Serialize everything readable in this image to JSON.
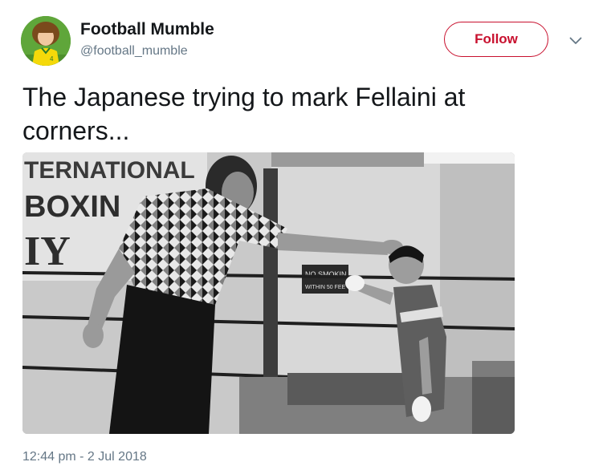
{
  "author": {
    "name": "Football Mumble",
    "handle": "@football_mumble",
    "avatar_icon": "cartoon-footballer-avatar"
  },
  "actions": {
    "follow_label": "Follow",
    "more_icon": "chevron-down-icon"
  },
  "tweet": {
    "text": "The Japanese trying to mark Fellaini at corners...",
    "timestamp": "12:44 pm - 2 Jul 2018"
  },
  "photo": {
    "sign_top": "TERNATIONAL",
    "sign_mid": "BOXIN",
    "sign_bottom": "IY",
    "notice_line1": "NO SMOKIN",
    "notice_line2": "WITHIN 50 FEE"
  },
  "colors": {
    "follow_accent": "#c8102e",
    "text_primary": "#14171a",
    "text_secondary": "#657786"
  }
}
